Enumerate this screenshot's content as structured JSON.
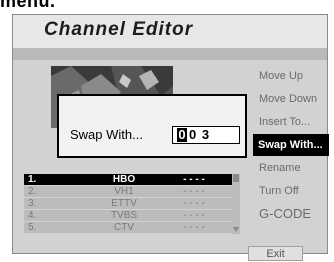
{
  "top_fragment": "menu.",
  "title": "Channel Editor",
  "menu": {
    "items": [
      {
        "label": "Move Up"
      },
      {
        "label": "Move Down"
      },
      {
        "label": "Insert To..."
      },
      {
        "label": "Swap With..."
      },
      {
        "label": "Rename"
      },
      {
        "label": "Turn Off"
      },
      {
        "label": "G-CODE"
      }
    ],
    "selected_index": 3,
    "exit_label": "Exit"
  },
  "dialog": {
    "label": "Swap With...",
    "input_value": "003",
    "input_cursor_digit": "0",
    "input_rest": "0 3"
  },
  "channel_list": [
    {
      "num": "1.",
      "name": "HBO",
      "status": "- - - -",
      "selected": true
    },
    {
      "num": "2.",
      "name": "VH1",
      "status": "- - - -",
      "selected": false
    },
    {
      "num": "3.",
      "name": "ETTV",
      "status": "- - - -",
      "selected": false
    },
    {
      "num": "4.",
      "name": "TVBS",
      "status": "- - - -",
      "selected": false
    },
    {
      "num": "5.",
      "name": "CTV",
      "status": "- - - -",
      "selected": false
    }
  ],
  "colors": {
    "panel_bg": "#d2d2d2",
    "selected_bg": "#000000",
    "menu_text": "#6b6b6b"
  }
}
